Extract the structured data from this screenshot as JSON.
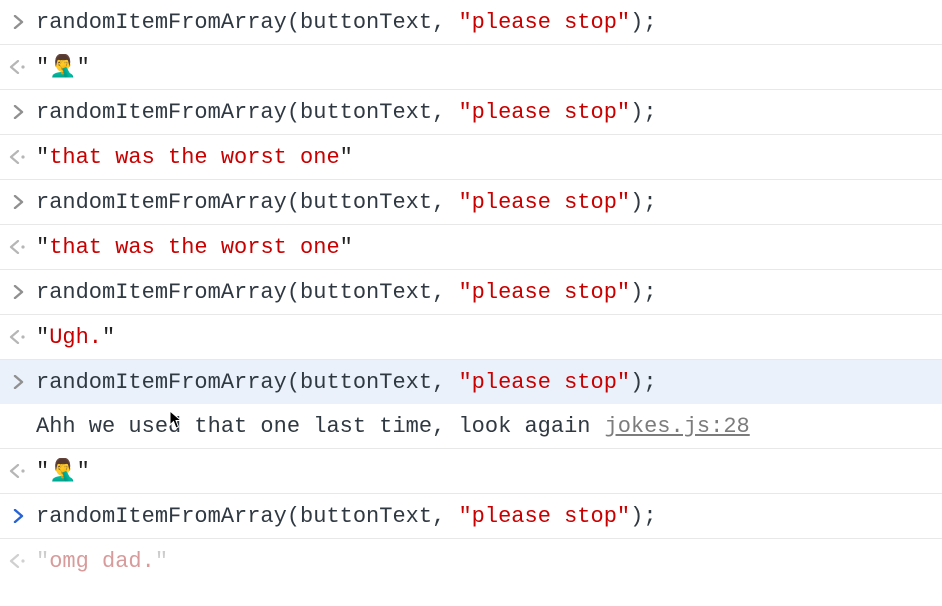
{
  "entries": [
    {
      "type": "input",
      "fn": "randomItemFromArray",
      "arg1": "buttonText",
      "arg2": "please stop"
    },
    {
      "type": "output",
      "value": "🤦‍♂️"
    },
    {
      "type": "input",
      "fn": "randomItemFromArray",
      "arg1": "buttonText",
      "arg2": "please stop"
    },
    {
      "type": "output",
      "value": "that was the worst one"
    },
    {
      "type": "input",
      "fn": "randomItemFromArray",
      "arg1": "buttonText",
      "arg2": "please stop"
    },
    {
      "type": "output",
      "value": "that was the worst one"
    },
    {
      "type": "input",
      "fn": "randomItemFromArray",
      "arg1": "buttonText",
      "arg2": "please stop"
    },
    {
      "type": "output",
      "value": "Ugh."
    },
    {
      "type": "input",
      "fn": "randomItemFromArray",
      "arg1": "buttonText",
      "arg2": "please stop",
      "highlight": true
    },
    {
      "type": "log",
      "message": "Ahh we used that one last time, look again",
      "source": "jokes.js:28"
    },
    {
      "type": "output",
      "value": "🤦‍♂️"
    },
    {
      "type": "input",
      "fn": "randomItemFromArray",
      "arg1": "buttonText",
      "arg2": "please stop",
      "blue": true
    },
    {
      "type": "output",
      "value": "omg dad.",
      "faded": true,
      "last": true
    }
  ],
  "icons": {
    "input_arrow": "chevron-right",
    "output_arrow": "chevron-left-dot"
  }
}
